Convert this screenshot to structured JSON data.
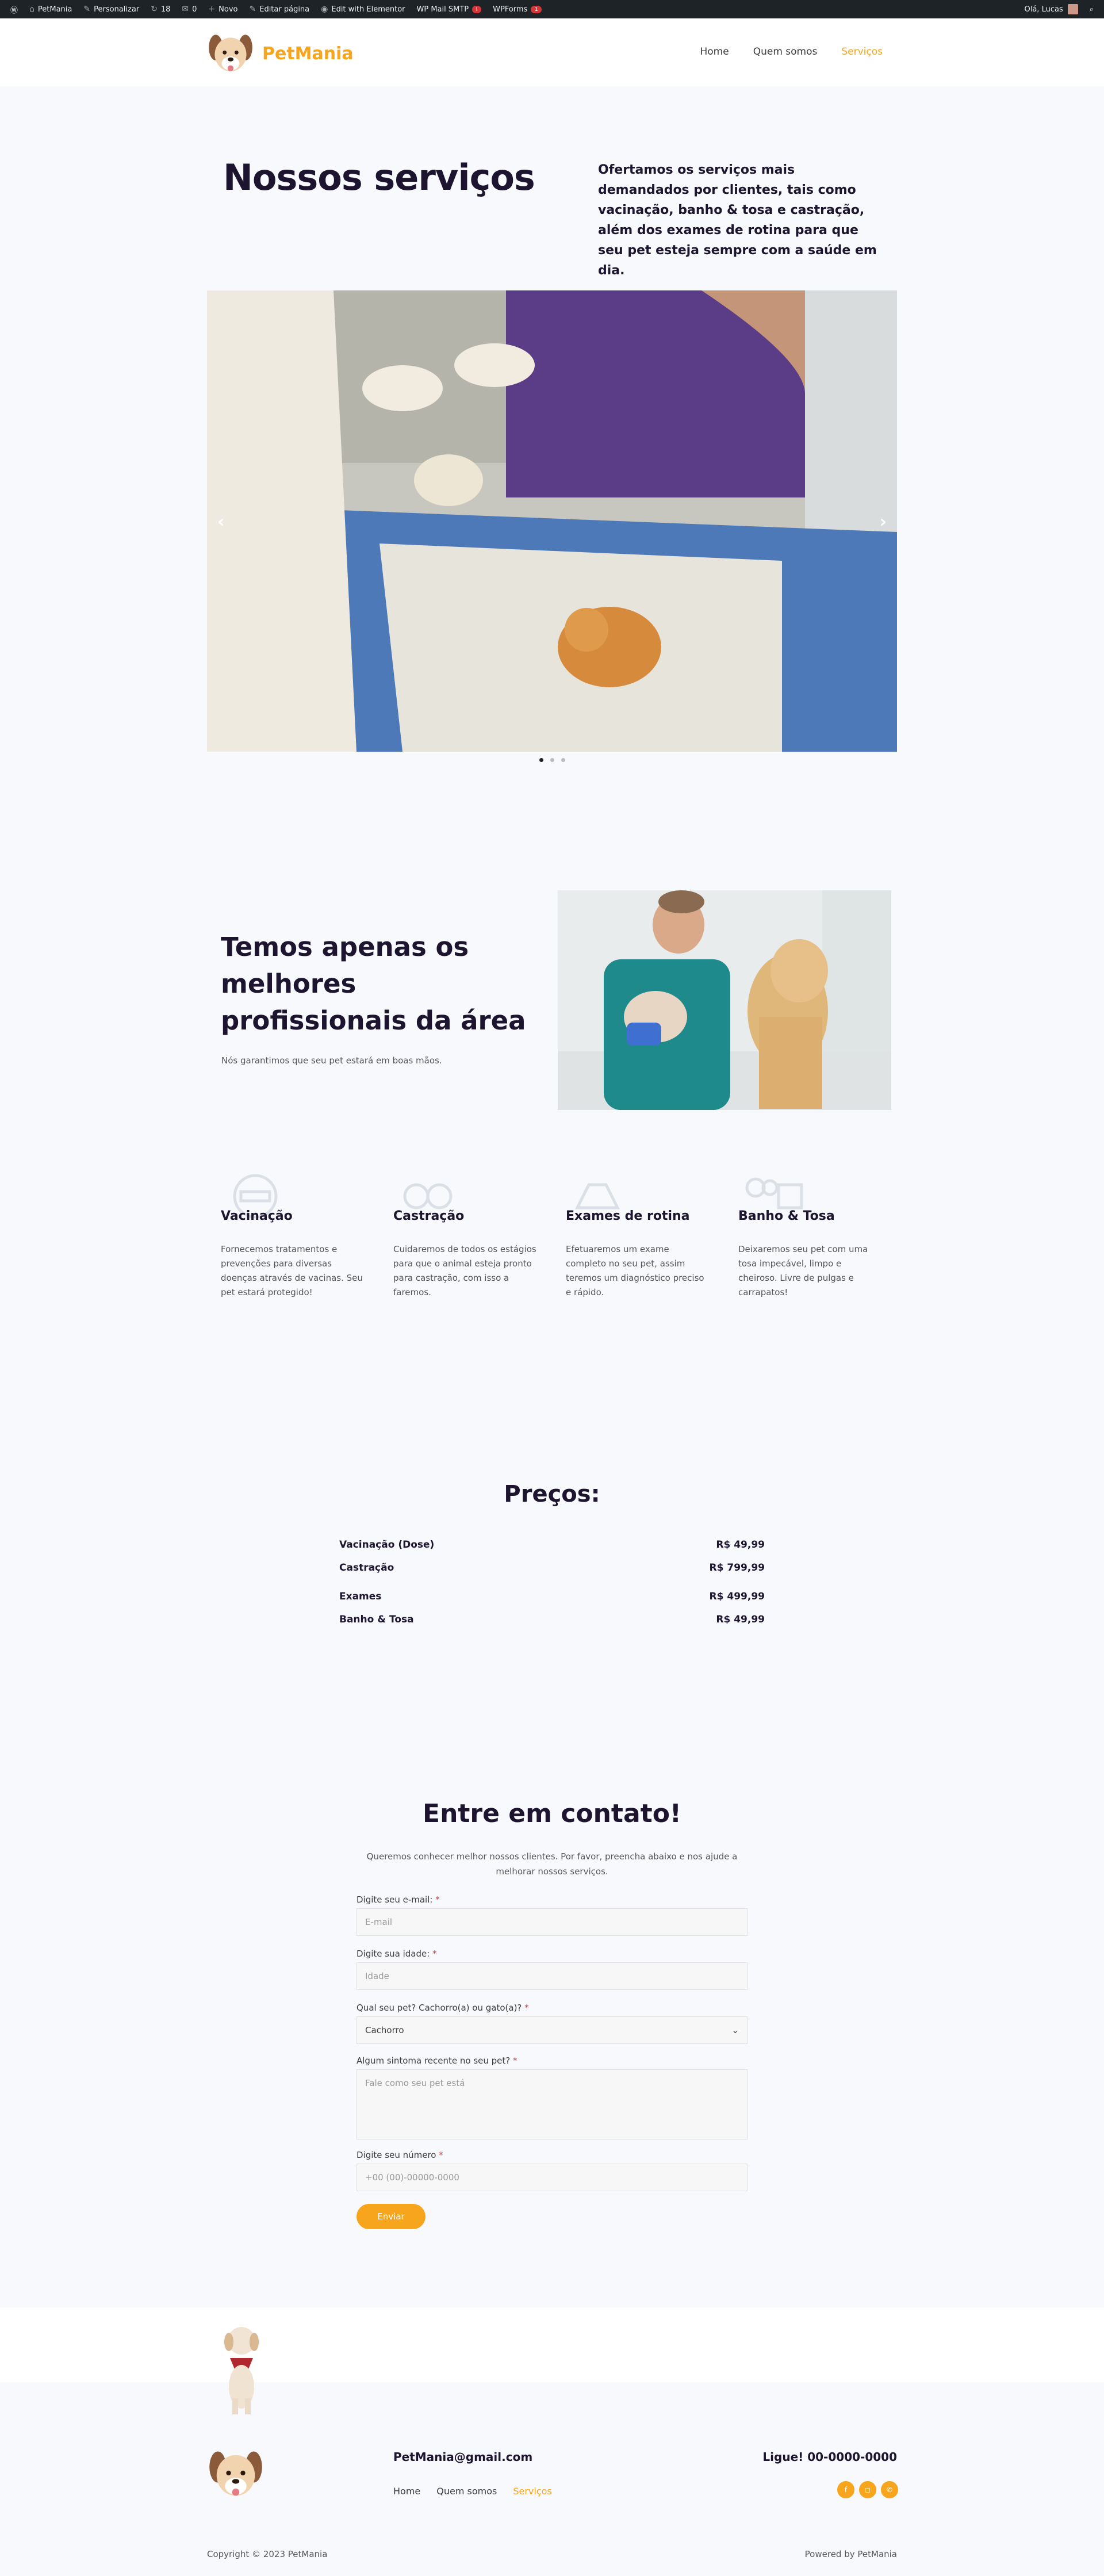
{
  "adminbar": {
    "items": [
      "PetMania",
      "Personalizar",
      "18",
      "0",
      "Novo",
      "Editar página",
      "Edit with Elementor",
      "WP Mail SMTP",
      "WPForms"
    ],
    "smtp_badge": "!",
    "wpforms_badge": "1",
    "greeting": "Olá, Lucas"
  },
  "header": {
    "brand": "PetMania",
    "nav": [
      "Home",
      "Quem somos",
      "Serviços"
    ],
    "active": "Serviços"
  },
  "hero": {
    "title": "Nossos serviços",
    "description": "Ofertamos os serviços mais demandados por clientes, tais como vacinação, banho & tosa e castração, além dos exames de rotina para que seu pet esteja sempre com a saúde em dia."
  },
  "pros": {
    "title": "Temos apenas os melhores profissionais da área",
    "text": "Nós garantimos que seu pet estará em boas mãos."
  },
  "services": [
    {
      "title": "Vacinação",
      "text": "Fornecemos tratamentos e prevenções para diversas doenças através de vacinas. Seu pet estará protegido!",
      "icon": "syringe-icon"
    },
    {
      "title": "Castração",
      "text": "Cuidaremos de todos os estágios para que o animal esteja pronto para castração, com isso a faremos.",
      "icon": "scissors-icon"
    },
    {
      "title": "Exames de rotina",
      "text": "Efetuaremos um exame completo no seu pet, assim teremos um diagnóstico preciso e rápido.",
      "icon": "stethoscope-icon"
    },
    {
      "title": "Banho & Tosa",
      "text": "Deixaremos seu pet com uma tosa impecável, limpo e cheiroso. Livre de pulgas e carrapatos!",
      "icon": "bath-icon"
    }
  ],
  "prices": {
    "title": "Preços:",
    "rows": [
      {
        "name": "Vacinação (Dose)",
        "price": "R$ 49,99"
      },
      {
        "name": "Castração",
        "price": "R$ 799,99"
      },
      {
        "name": "Exames",
        "price": "R$ 499,99"
      },
      {
        "name": "Banho & Tosa",
        "price": "R$ 49,99"
      }
    ]
  },
  "contact": {
    "title": "Entre em contato!",
    "intro": "Queremos conhecer melhor nossos clientes. Por favor, preencha abaixo e nos ajude a melhorar nossos serviços.",
    "email_label": "Digite seu e-mail:",
    "email_placeholder": "E-mail",
    "age_label": "Digite sua idade:",
    "age_placeholder": "Idade",
    "pet_label": "Qual seu pet? Cachorro(a) ou gato(a)?",
    "pet_value": "Cachorro",
    "symptom_label": "Algum sintoma recente no seu pet?",
    "symptom_placeholder": "Fale como seu pet está",
    "phone_label": "Digite seu número",
    "phone_placeholder": "+00 (00)-00000-0000",
    "required_mark": "*",
    "submit": "Enviar"
  },
  "footer": {
    "email": "PetMania@gmail.com",
    "phone": "Ligue! 00-0000-0000",
    "nav": [
      "Home",
      "Quem somos",
      "Serviços"
    ],
    "copyright": "Copyright © 2023 PetMania",
    "powered": "Powered by PetMania"
  },
  "colors": {
    "accent": "#f7a51c",
    "dark": "#1d1530"
  }
}
